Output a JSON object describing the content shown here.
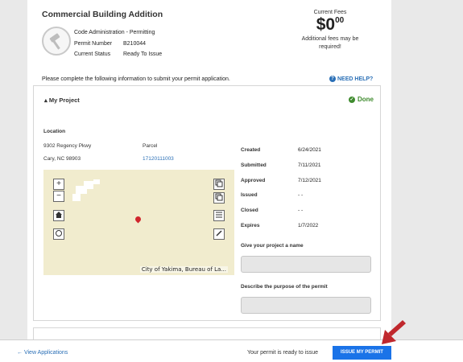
{
  "header": {
    "title": "Commercial Building Addition",
    "department": "Code Administration - Permitting",
    "permit_number_label": "Permit Number",
    "permit_number": "B210044",
    "status_label": "Current Status",
    "status": "Ready To Issue"
  },
  "fees": {
    "label": "Current Fees",
    "dollars": "$0",
    "cents": "00",
    "note": "Additional fees may be required!"
  },
  "instructions": "Please complete the following information to submit your permit application.",
  "help_label": "NEED HELP?",
  "project": {
    "heading": "My Project",
    "status": "Done",
    "location_label": "Location",
    "address_line1": "9302 Regency Pkwy",
    "address_line2": "Cary, NC 98903",
    "parcel_label": "Parcel",
    "parcel_value": "17120111003",
    "map_attribution": "City of Yakima, Bureau of La...",
    "dates": [
      {
        "label": "Created",
        "value": "6/24/2021"
      },
      {
        "label": "Submitted",
        "value": "7/11/2021"
      },
      {
        "label": "Approved",
        "value": "7/12/2021"
      },
      {
        "label": "Issued",
        "value": "- -"
      },
      {
        "label": "Closed",
        "value": "- -"
      },
      {
        "label": "Expires",
        "value": "1/7/2022"
      }
    ],
    "name_label": "Give your project a name",
    "name_value": "",
    "purpose_label": "Describe the purpose of the permit",
    "purpose_value": ""
  },
  "footer": {
    "back_label": "View Applications",
    "ready_text": "Your permit is ready to issue",
    "issue_button": "ISSUE MY PERMIT"
  },
  "colors": {
    "link_blue": "#2a6fb6",
    "button_blue": "#1a73e8",
    "done_green": "#3f8b2e",
    "arrow_red": "#c0282d",
    "map_background": "#f1ecce"
  }
}
